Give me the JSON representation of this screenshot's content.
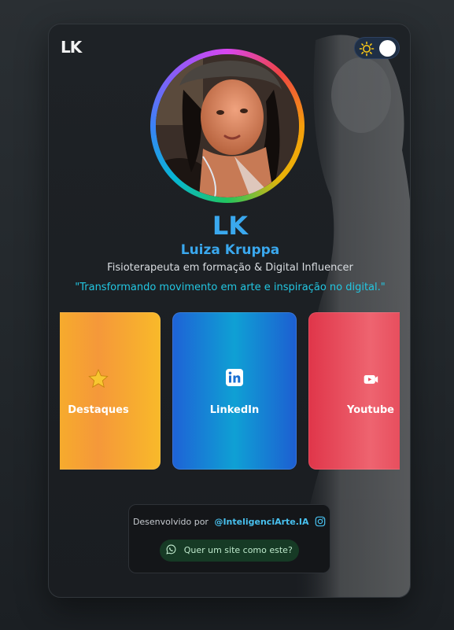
{
  "brand": {
    "logo_text": "LK"
  },
  "theme_toggle": {
    "icon": "sun-icon",
    "state": "light"
  },
  "profile": {
    "avatar_icon": "profile-photo",
    "monogram": "LK",
    "name": "Luiza Kruppa",
    "role": "Fisioterapeuta em formação & Digital Influencer",
    "quote": "\"Transformando movimento em arte e inspiração no digital.\""
  },
  "links": [
    {
      "label": "Destaques",
      "icon": "star-icon",
      "color": "#f7a92f"
    },
    {
      "label": "LinkedIn",
      "icon": "linkedin-icon",
      "color": "#1a7fd6"
    },
    {
      "label": "Youtube",
      "icon": "youtube-icon",
      "color": "#e84b5a"
    }
  ],
  "footer": {
    "dev_label": "Desenvolvido por",
    "dev_handle": "@InteligenciArte.IA",
    "dev_icon": "instagram-icon",
    "cta_label": "Quer um site como este?",
    "cta_icon": "whatsapp-icon"
  },
  "colors": {
    "accent": "#3aa8ee",
    "quote": "#22c7e2",
    "background": "#1b1f23"
  }
}
